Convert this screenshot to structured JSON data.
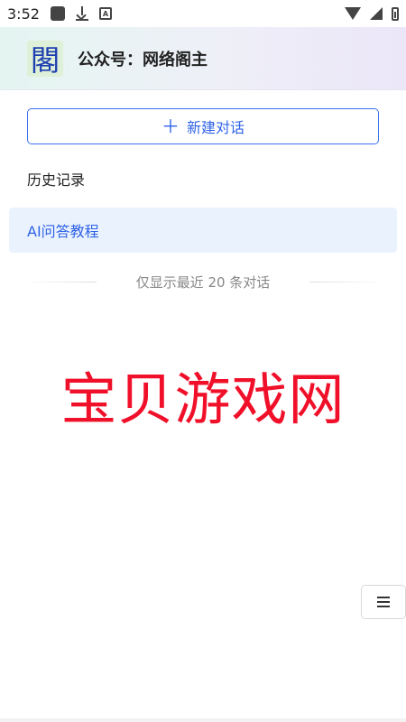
{
  "status_bar": {
    "time": "3:52",
    "icons": [
      "app-notification-icon",
      "download-icon",
      "a-badge-icon",
      "wifi-icon",
      "signal-icon",
      "battery-icon"
    ]
  },
  "header": {
    "logo_glyph": "閣",
    "title": "公众号：网络阁主"
  },
  "new_chat": {
    "icon": "plus-icon",
    "label": "新建对话",
    "accent": "#2f63e6"
  },
  "history": {
    "label": "历史记录",
    "items": [
      {
        "label": "AI问答教程",
        "selected": true
      }
    ]
  },
  "hint": "仅显示最近 20 条对话",
  "watermark": "宝贝游戏网",
  "menu_button": {
    "icon": "menu-list-icon"
  }
}
